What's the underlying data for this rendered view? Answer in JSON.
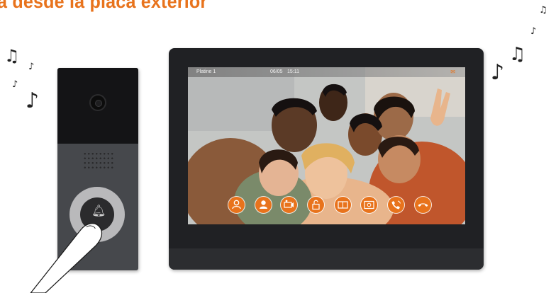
{
  "headline": "a desde la placa exterior",
  "notes": [
    "♫",
    "♪",
    "♫",
    "♪",
    "♪",
    "♫",
    "♪",
    "♫",
    "♪",
    "♪"
  ],
  "screen": {
    "station_name": "Platine 1",
    "date": "06/05",
    "time": "15:11"
  },
  "buttons": [
    {
      "name": "monitor-user-icon"
    },
    {
      "name": "intercom-user-icon"
    },
    {
      "name": "camera-icon"
    },
    {
      "name": "unlock-icon"
    },
    {
      "name": "gate-icon"
    },
    {
      "name": "snapshot-icon"
    },
    {
      "name": "answer-call-icon"
    },
    {
      "name": "hang-up-icon"
    }
  ],
  "colors": {
    "accent": "#e8731c",
    "monitor": "#202124",
    "panel": "#46484c"
  }
}
